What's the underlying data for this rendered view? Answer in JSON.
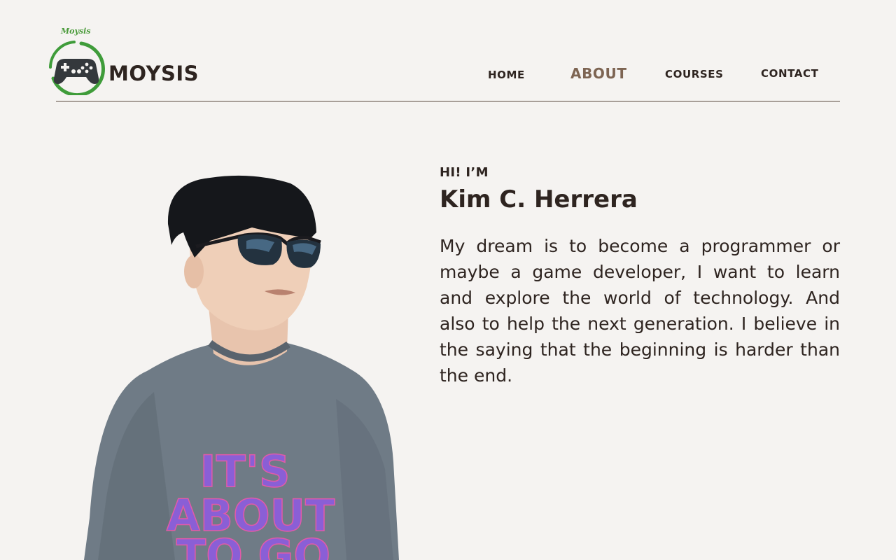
{
  "brand": {
    "script_name": "Moysis",
    "name": "MOYSIS",
    "logo_icon": "gamepad-icon",
    "ring_color": "#3f9c3a"
  },
  "nav": {
    "items": [
      {
        "label": "HOME"
      },
      {
        "label": "ABOUT"
      },
      {
        "label": "COURSES"
      },
      {
        "label": "CONTACT"
      }
    ],
    "active_color": "#7d6452"
  },
  "hero": {
    "greeting": "HI! I’M",
    "name": "Kim C. Herrera",
    "bio": "My dream is to become a programmer or maybe a game developer, I want to learn and explore the world of technology. And also to help the next generation. I believe in the saying that the beginning is harder than the end.",
    "shirt_text": [
      "IT'S",
      "ABOUT",
      "TO GO"
    ]
  }
}
